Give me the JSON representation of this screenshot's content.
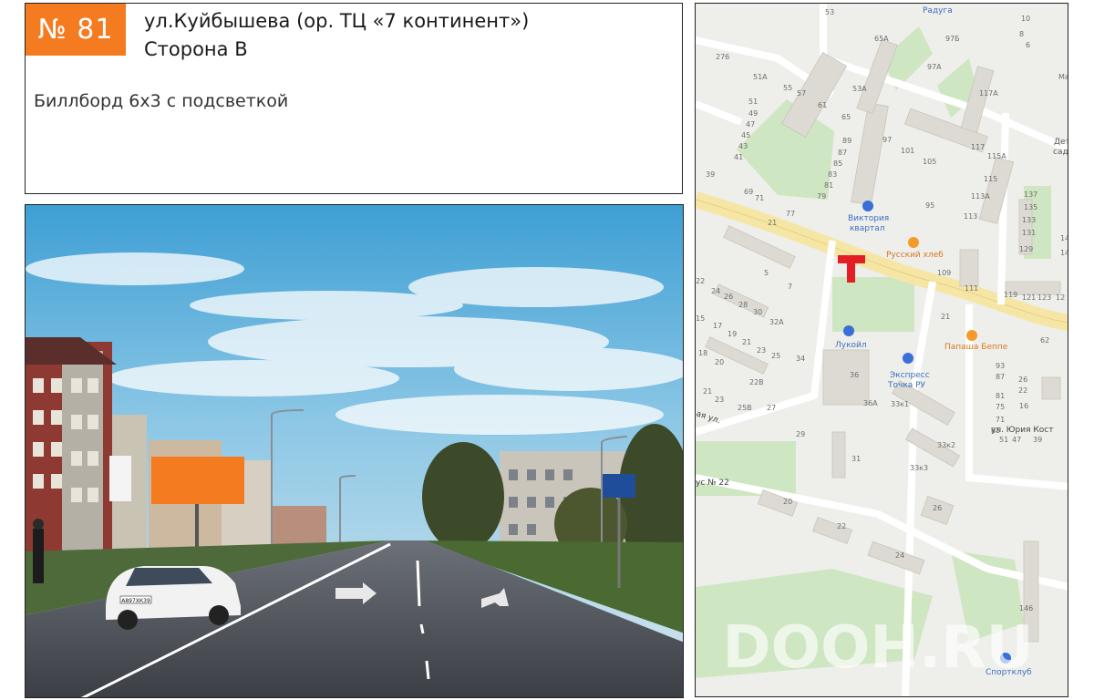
{
  "listing": {
    "number": "№ 81",
    "address_line1": "ул.Куйбышева (ор. ТЦ «7 континент»)",
    "address_line2": "Сторона B",
    "description": "Биллборд 6х3 с подсветкой"
  },
  "photo": {
    "plate": "А897ХК39"
  },
  "map": {
    "watermark": "DOOH.RU",
    "pois": {
      "raduga": "Радуга",
      "viktoria_1": "Виктория",
      "viktoria_2": "квартал",
      "russkiy_hleb": "Русский хлеб",
      "lukoil": "Лукойл",
      "express_1": "Экспресс",
      "express_2": "Точка РУ",
      "papasha": "Папаша Беппе",
      "sportklub": "Спортклуб",
      "det_1": "Дет",
      "det_2": "сад"
    },
    "streets": {
      "yuriya": "ул. Юрия Кост",
      "ul_frag": "ая ул.",
      "bus22": "ус № 22"
    },
    "house_numbers": [
      "53",
      "65А",
      "97Б",
      "10",
      "8",
      "6",
      "276",
      "51А",
      "55",
      "57",
      "61",
      "65",
      "53А",
      "97А",
      "117А",
      "51",
      "49",
      "47",
      "45",
      "43",
      "41",
      "89",
      "87",
      "85",
      "83",
      "81",
      "79",
      "97",
      "101",
      "105",
      "117",
      "115А",
      "115",
      "39",
      "69",
      "71",
      "77",
      "95",
      "113А",
      "113",
      "137",
      "135",
      "133",
      "131",
      "129",
      "5",
      "7",
      "109",
      "111",
      "119",
      "121",
      "123",
      "12",
      "22",
      "24",
      "26",
      "28",
      "30",
      "32А",
      "15",
      "17",
      "19",
      "21",
      "23",
      "25",
      "34",
      "62",
      "18",
      "20",
      "22В",
      "36",
      "93",
      "87",
      "81",
      "75",
      "71",
      "65",
      "51",
      "47",
      "39",
      "26",
      "22",
      "16",
      "21",
      "23",
      "25В",
      "27",
      "36А",
      "33к1",
      "29",
      "31",
      "33к2",
      "33к3",
      "20",
      "22",
      "24",
      "26",
      "146",
      "14",
      "14",
      "21",
      "21",
      "Ма"
    ]
  }
}
